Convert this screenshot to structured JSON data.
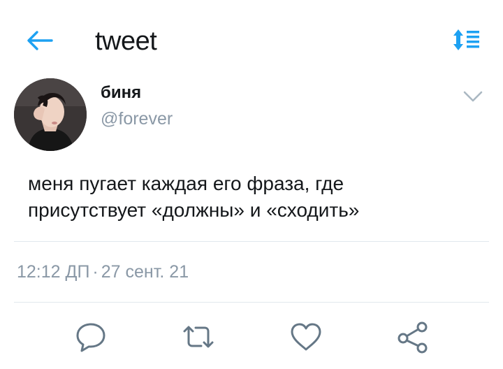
{
  "header": {
    "title": "tweet",
    "back_icon": "arrow-left-icon",
    "sort_icon": "sort-list-icon",
    "accent_color": "#1da1f2"
  },
  "tweet": {
    "author_name": "биня",
    "handle": "@forever",
    "avatar_icon": "user-avatar",
    "more_icon": "chevron-down-icon",
    "text_line1": "меня пугает каждая его фраза, где",
    "text_line2": "присутствует «должны» и «сходить»",
    "time": "12:12 ДП",
    "separator": "·",
    "date": "27 сент. 21"
  },
  "actions": [
    {
      "icon": "reply-icon"
    },
    {
      "icon": "retweet-icon"
    },
    {
      "icon": "like-icon"
    },
    {
      "icon": "share-icon"
    }
  ],
  "colors": {
    "text": "#14171a",
    "secondary": "#8a98a6",
    "divider": "#e1e8ed",
    "icon_gray": "#657786"
  }
}
